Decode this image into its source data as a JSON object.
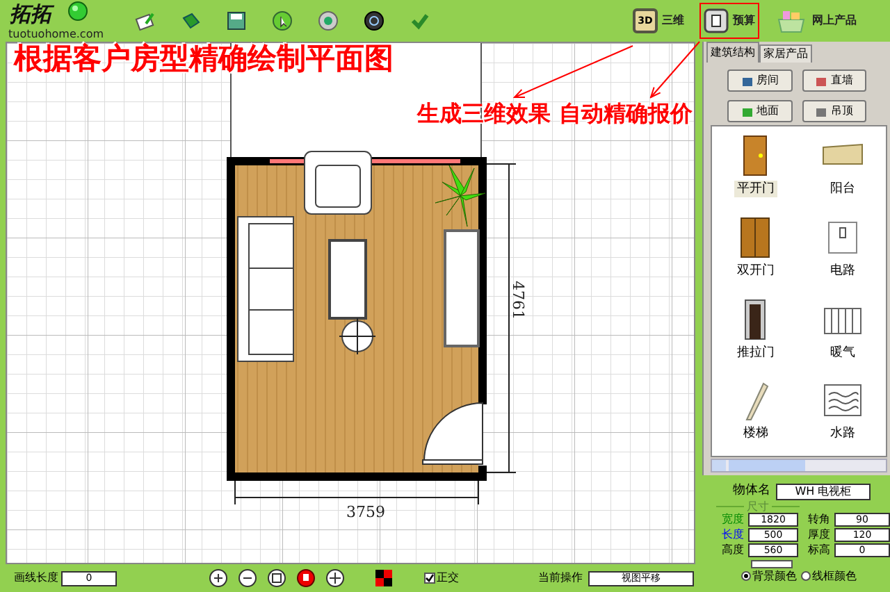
{
  "toolbar": {
    "logo_text": "拓拓",
    "logo_site": "tuotuohome.com",
    "buttons": [
      {
        "kind": "view",
        "badge": "3D",
        "label": "三维",
        "highlighted": false
      },
      {
        "kind": "budget",
        "label": "预算",
        "highlighted": true
      },
      {
        "kind": "shop",
        "label": "网上产品",
        "highlighted": false
      }
    ]
  },
  "annotations": [
    {
      "text": "根据客户房型精确绘制平面图"
    },
    {
      "text": "生成三维效果"
    },
    {
      "text": "自动精确报价"
    }
  ],
  "floor_plan": {
    "width_label": "3759",
    "height_label": "4761"
  },
  "panel": {
    "tabs": [
      {
        "label": "建筑结构",
        "selected": true
      },
      {
        "label": "家居产品",
        "selected": false
      }
    ],
    "buttons": [
      {
        "kind": "room",
        "label": "房间"
      },
      {
        "kind": "wall",
        "label": "直墙"
      },
      {
        "kind": "floor",
        "label": "地面"
      },
      {
        "kind": "ceiling",
        "label": "吊顶"
      }
    ],
    "items": [
      {
        "kind": "door",
        "label": "平开门",
        "selected": true
      },
      {
        "kind": "balcony",
        "label": "阳台",
        "selected": false
      },
      {
        "kind": "double-door",
        "label": "双开门",
        "selected": false
      },
      {
        "kind": "switch",
        "label": "电路",
        "selected": false
      },
      {
        "kind": "sliding-door",
        "label": "推拉门",
        "selected": false
      },
      {
        "kind": "radiator",
        "label": "暖气",
        "selected": false
      },
      {
        "kind": "stairs",
        "label": "楼梯",
        "selected": false
      },
      {
        "kind": "water",
        "label": "水路",
        "selected": false
      }
    ]
  },
  "properties": {
    "name_label": "物体名",
    "name_value": "WH 电视柜",
    "group_label": "尺寸",
    "fields": [
      {
        "label": "宽度",
        "value": "1820",
        "color": "#008800"
      },
      {
        "label": "转角",
        "value": "90",
        "color": "#000000"
      },
      {
        "label": "长度",
        "value": "500",
        "color": "#0000ff"
      },
      {
        "label": "厚度",
        "value": "120",
        "color": "#000000"
      },
      {
        "label": "高度",
        "value": "560",
        "color": "#000000"
      },
      {
        "label": "标高",
        "value": "0",
        "color": "#000000"
      }
    ],
    "radios": [
      {
        "label": "背景颜色",
        "selected": true
      },
      {
        "label": "线框颜色",
        "selected": false
      }
    ]
  },
  "status_bar": {
    "line_length_label": "画线长度",
    "line_length_value": "0",
    "ortho_label": "正交",
    "ortho_checked": true,
    "operation_label": "当前操作",
    "operation_value": "视图平移"
  }
}
